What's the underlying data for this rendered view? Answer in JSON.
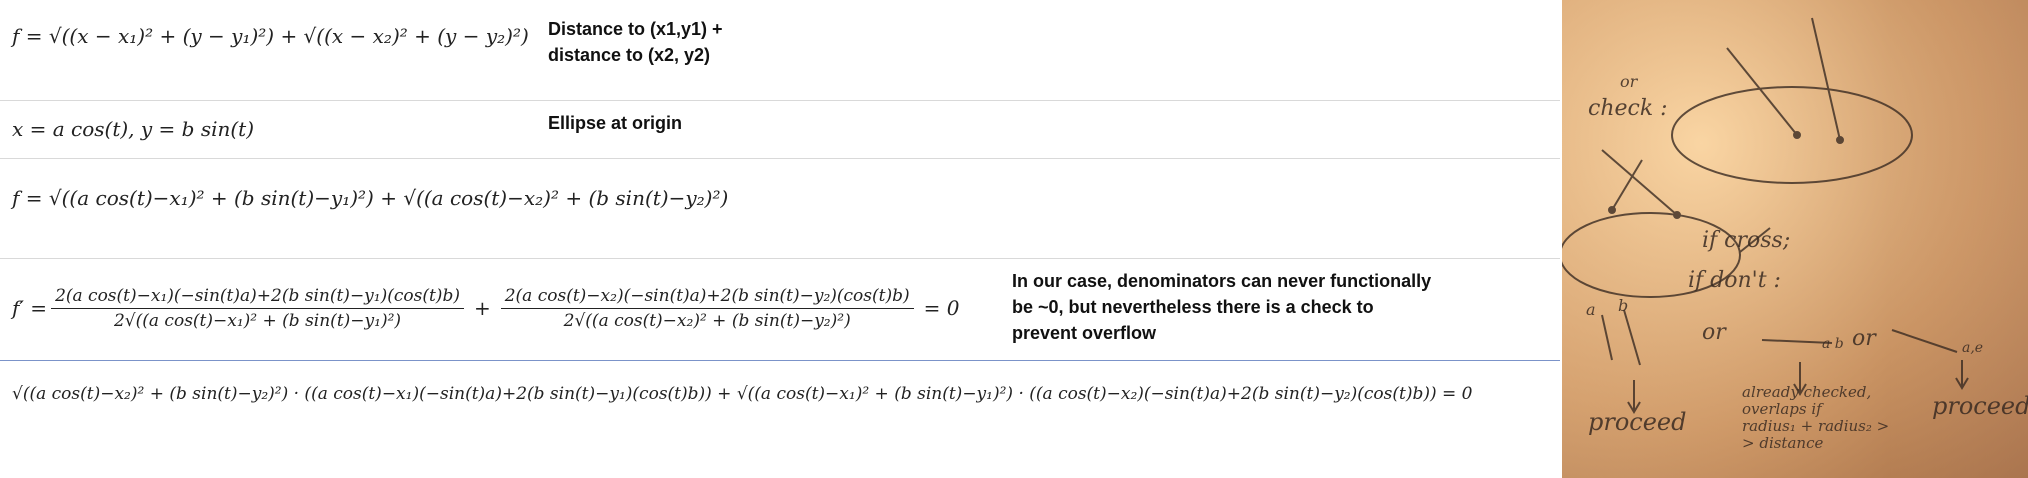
{
  "notes": {
    "distance": "Distance to (x1,y1) + distance to (x2, y2)",
    "distance_line1": "Distance to (x1,y1) +",
    "distance_line2": "distance to (x2, y2)",
    "ellipse": "Ellipse at origin",
    "denominators_line1": "In our case, denominators can never functionally",
    "denominators_line2": "be ~0, but nevertheless there is a check to",
    "denominators_line3": "prevent overflow"
  },
  "equations": {
    "eq1": "f = √((x − x₁)² + (y − y₁)²) + √((x − x₂)² + (y − y₂)²)",
    "eq2": "x = a cos(t), y = b sin(t)",
    "eq3": "f = √((a cos(t)−x₁)² + (b sin(t)−y₁)²) + √((a cos(t)−x₂)² + (b sin(t)−y₂)²)",
    "eq4_lhs": "f′ =",
    "eq4_num1": "2(a cos(t)−x₁)(−sin(t)a)+2(b sin(t)−y₁)(cos(t)b)",
    "eq4_den1": "2√((a cos(t)−x₁)² + (b sin(t)−y₁)²)",
    "eq4_plus": "+",
    "eq4_num2": "2(a cos(t)−x₂)(−sin(t)a)+2(b sin(t)−y₂)(cos(t)b)",
    "eq4_den2": "2√((a cos(t)−x₂)² + (b sin(t)−y₂)²)",
    "eq4_rhs": "= 0",
    "eq5": "√((a cos(t)−x₂)² + (b sin(t)−y₂)²) · ((a cos(t)−x₁)(−sin(t)a)+2(b sin(t)−y₁)(cos(t)b)) + √((a cos(t)−x₁)² + (b sin(t)−y₁)²) · ((a cos(t)−x₂)(−sin(t)a)+2(b sin(t)−y₂)(cos(t)b)) = 0"
  },
  "sketch": {
    "or_top": "or",
    "check": "check :",
    "if_cross": "if cross;",
    "if_dont": "if don't :",
    "or_mid": "or",
    "or_right": "or",
    "proceed_left": "proceed",
    "already_checked": "already checked, overlaps if radius₁+radius₂ > distance",
    "already_line1": "already checked,",
    "already_line2": "overlaps if",
    "already_line3": "radius₁ + radius₂ >",
    "already_line4": "> distance",
    "proceed_right": "proceed",
    "label_a": "a",
    "label_b": "b",
    "label_ab": "a  b",
    "label_ae": "a,e"
  }
}
